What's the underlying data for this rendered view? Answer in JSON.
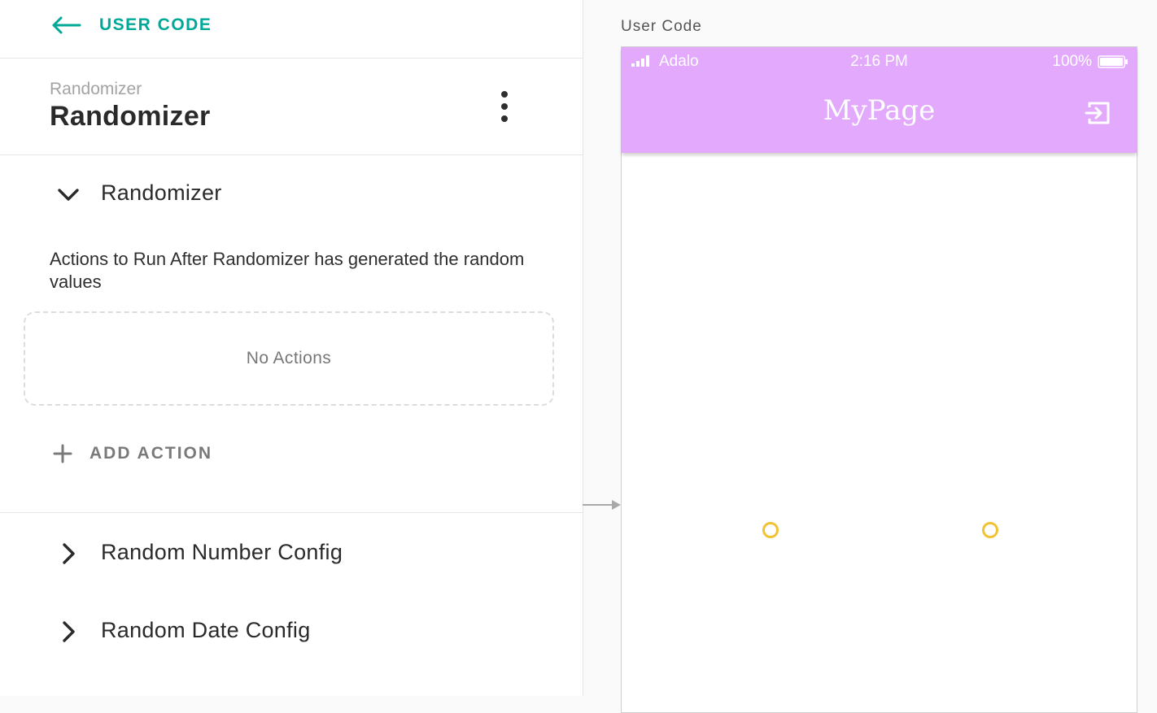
{
  "nav": {
    "back_label": "USER CODE"
  },
  "component": {
    "subtitle": "Randomizer",
    "title": "Randomizer"
  },
  "sections": {
    "main": {
      "label": "Randomizer",
      "description": "Actions to Run After Randomizer has generated the random values",
      "empty_actions": "No Actions",
      "add_action_label": "ADD ACTION"
    },
    "number_config": {
      "label": "Random Number Config"
    },
    "date_config": {
      "label": "Random Date Config"
    }
  },
  "canvas": {
    "screen_name": "User Code",
    "status_bar": {
      "carrier": "Adalo",
      "time": "2:16 PM",
      "battery": "100%"
    },
    "app_bar": {
      "title": "MyPage",
      "color": "#e2a9fc"
    }
  },
  "colors": {
    "accent": "#00a898",
    "handle": "#f1c232"
  }
}
